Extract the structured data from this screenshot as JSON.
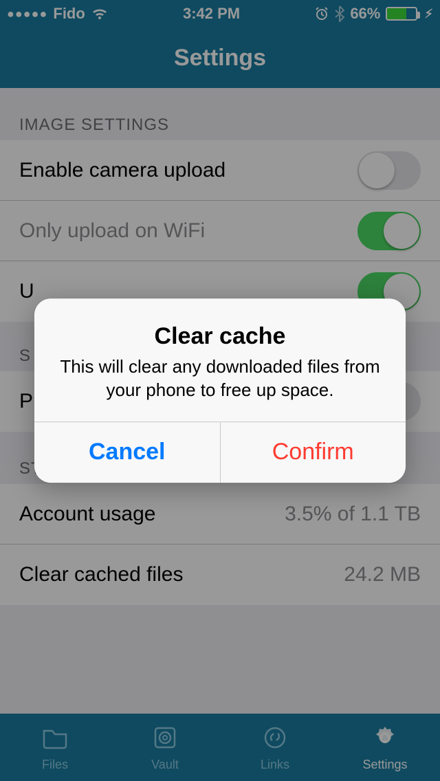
{
  "status": {
    "signal_dots": "●●●●●",
    "carrier": "Fido",
    "time": "3:42 PM",
    "battery_pct": "66%"
  },
  "header": {
    "title": "Settings"
  },
  "sections": {
    "image": {
      "header": "IMAGE SETTINGS",
      "enable_camera": "Enable camera upload",
      "only_wifi": "Only upload on WiFi",
      "row3_prefix": "U"
    },
    "section2": {
      "header_prefix": "S",
      "row_prefix": "P"
    },
    "storage": {
      "header": "STORAGE",
      "account_usage_label": "Account usage",
      "account_usage_value": "3.5% of  1.1 TB",
      "clear_cached_label": "Clear cached files",
      "clear_cached_value": "24.2 MB"
    }
  },
  "tabs": {
    "files": "Files",
    "vault": "Vault",
    "links": "Links",
    "settings": "Settings"
  },
  "alert": {
    "title": "Clear cache",
    "message": "This will clear any downloaded files from your phone to free up space.",
    "cancel": "Cancel",
    "confirm": "Confirm"
  }
}
